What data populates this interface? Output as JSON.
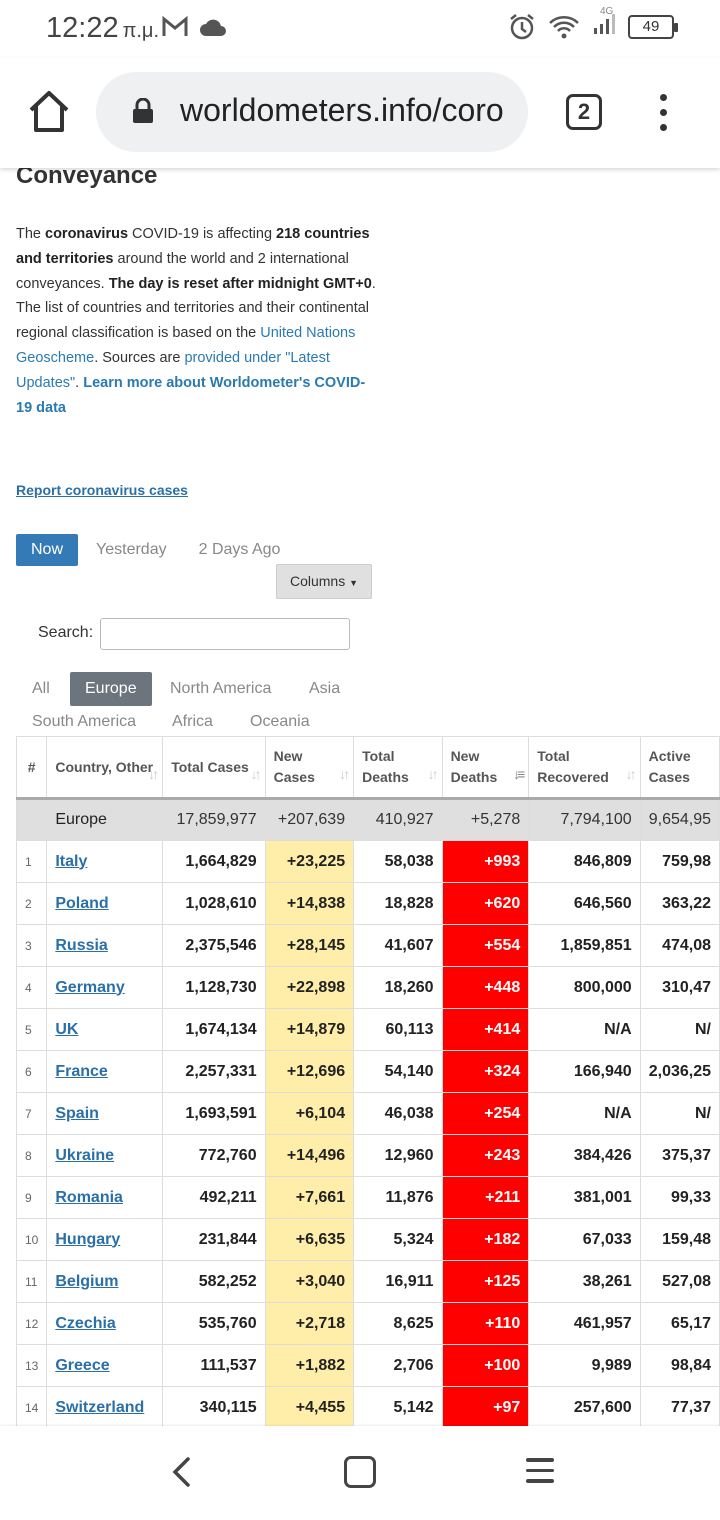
{
  "status_bar": {
    "time": "12:22",
    "ampm": "π.μ.",
    "battery": "49",
    "network": "4G",
    "icons": [
      "gmail-icon",
      "cloud-icon",
      "alarm-icon",
      "wifi-icon",
      "signal-icon",
      "battery-icon"
    ]
  },
  "browser": {
    "url": "worldometers.info/coro",
    "tab_count": "2"
  },
  "page": {
    "section_heading": "Conveyance",
    "intro": {
      "p1": "The ",
      "b1": "coronavirus",
      "p2": " COVID-19 is affecting ",
      "b2": "218 countries and territories",
      "p3": " around the world and 2 international conveyances. ",
      "b3": "The day is reset after midnight GMT+0",
      "p4": ". The list of countries and territories and their continental regional classification is based on the ",
      "link1": "United Nations Geoscheme",
      "p5": ". Sources are ",
      "link2": "provided under \"Latest Updates\"",
      "p6": ". ",
      "link3": "Learn more about Worldometer's COVID-19 data"
    },
    "report_link": "Report coronavirus cases",
    "day_tabs": [
      "Now",
      "Yesterday",
      "2 Days Ago"
    ],
    "columns_button": "Columns",
    "search_label": "Search:",
    "search_value": "",
    "region_tabs": [
      "All",
      "Europe",
      "North America",
      "Asia",
      "South America",
      "Africa",
      "Oceania"
    ]
  },
  "table": {
    "headers": [
      "#",
      "Country, Other",
      "Total Cases",
      "New Cases",
      "Total Deaths",
      "New Deaths",
      "Total Recovered",
      "Active Cases"
    ],
    "total_row": {
      "num": "",
      "country": "Europe",
      "total_cases": "17,859,977",
      "new_cases": "+207,639",
      "total_deaths": "410,927",
      "new_deaths": "+5,278",
      "total_recovered": "7,794,100",
      "active_cases": "9,654,95"
    },
    "rows": [
      {
        "num": "1",
        "country": "Italy",
        "total_cases": "1,664,829",
        "new_cases": "+23,225",
        "total_deaths": "58,038",
        "new_deaths": "+993",
        "total_recovered": "846,809",
        "active_cases": "759,98"
      },
      {
        "num": "2",
        "country": "Poland",
        "total_cases": "1,028,610",
        "new_cases": "+14,838",
        "total_deaths": "18,828",
        "new_deaths": "+620",
        "total_recovered": "646,560",
        "active_cases": "363,22"
      },
      {
        "num": "3",
        "country": "Russia",
        "total_cases": "2,375,546",
        "new_cases": "+28,145",
        "total_deaths": "41,607",
        "new_deaths": "+554",
        "total_recovered": "1,859,851",
        "active_cases": "474,08"
      },
      {
        "num": "4",
        "country": "Germany",
        "total_cases": "1,128,730",
        "new_cases": "+22,898",
        "total_deaths": "18,260",
        "new_deaths": "+448",
        "total_recovered": "800,000",
        "active_cases": "310,47"
      },
      {
        "num": "5",
        "country": "UK",
        "total_cases": "1,674,134",
        "new_cases": "+14,879",
        "total_deaths": "60,113",
        "new_deaths": "+414",
        "total_recovered": "N/A",
        "active_cases": "N/"
      },
      {
        "num": "6",
        "country": "France",
        "total_cases": "2,257,331",
        "new_cases": "+12,696",
        "total_deaths": "54,140",
        "new_deaths": "+324",
        "total_recovered": "166,940",
        "active_cases": "2,036,25"
      },
      {
        "num": "7",
        "country": "Spain",
        "total_cases": "1,693,591",
        "new_cases": "+6,104",
        "total_deaths": "46,038",
        "new_deaths": "+254",
        "total_recovered": "N/A",
        "active_cases": "N/"
      },
      {
        "num": "8",
        "country": "Ukraine",
        "total_cases": "772,760",
        "new_cases": "+14,496",
        "total_deaths": "12,960",
        "new_deaths": "+243",
        "total_recovered": "384,426",
        "active_cases": "375,37"
      },
      {
        "num": "9",
        "country": "Romania",
        "total_cases": "492,211",
        "new_cases": "+7,661",
        "total_deaths": "11,876",
        "new_deaths": "+211",
        "total_recovered": "381,001",
        "active_cases": "99,33"
      },
      {
        "num": "10",
        "country": "Hungary",
        "total_cases": "231,844",
        "new_cases": "+6,635",
        "total_deaths": "5,324",
        "new_deaths": "+182",
        "total_recovered": "67,033",
        "active_cases": "159,48"
      },
      {
        "num": "11",
        "country": "Belgium",
        "total_cases": "582,252",
        "new_cases": "+3,040",
        "total_deaths": "16,911",
        "new_deaths": "+125",
        "total_recovered": "38,261",
        "active_cases": "527,08"
      },
      {
        "num": "12",
        "country": "Czechia",
        "total_cases": "535,760",
        "new_cases": "+2,718",
        "total_deaths": "8,625",
        "new_deaths": "+110",
        "total_recovered": "461,957",
        "active_cases": "65,17"
      },
      {
        "num": "13",
        "country": "Greece",
        "total_cases": "111,537",
        "new_cases": "+1,882",
        "total_deaths": "2,706",
        "new_deaths": "+100",
        "total_recovered": "9,989",
        "active_cases": "98,84"
      },
      {
        "num": "14",
        "country": "Switzerland",
        "total_cases": "340,115",
        "new_cases": "+4,455",
        "total_deaths": "5,142",
        "new_deaths": "+97",
        "total_recovered": "257,600",
        "active_cases": "77,37"
      }
    ]
  },
  "colors": {
    "link": "#2a6fa8",
    "active_tab": "#337ab7",
    "region_active": "#6c757d",
    "new_cases_bg": "#ffeeaa",
    "new_deaths_bg": "#ff0000"
  }
}
